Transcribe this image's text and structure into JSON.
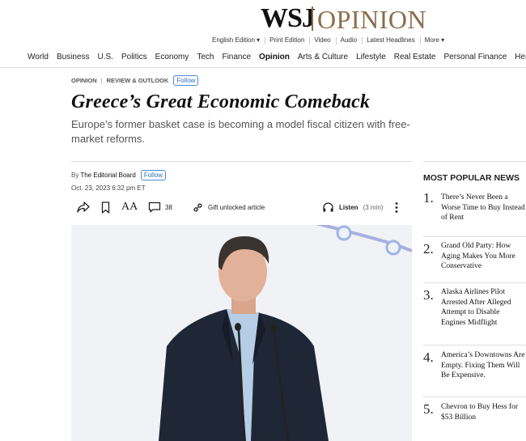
{
  "masthead": {
    "brand": "WSJ",
    "section": "OPINION"
  },
  "utility_nav": [
    "English Edition ▾",
    "Print Edition",
    "Video",
    "Audio",
    "Latest Headlines",
    "More ▾"
  ],
  "main_nav": [
    "World",
    "Business",
    "U.S.",
    "Politics",
    "Economy",
    "Tech",
    "Finance",
    "Opinion",
    "Arts & Culture",
    "Lifestyle",
    "Real Estate",
    "Personal Finance",
    "Hea"
  ],
  "main_nav_active": "Opinion",
  "article": {
    "kicker_1": "OPINION",
    "kicker_2": "REVIEW & OUTLOOK",
    "follow_label": "Follow",
    "headline": "Greece’s Great Economic Comeback",
    "dek": "Europe’s former basket case is becoming a model fiscal citizen with free-market reforms.",
    "byline_prefix": "By",
    "author": "The Editorial Board",
    "author_follow_label": "Follow",
    "date": "Oct. 23, 2023 6:32 pm ET",
    "comment_count": "38",
    "gift_label": "Gift unlocked article",
    "listen_label": "Listen",
    "listen_duration": "(3 min)",
    "font_size_label": "AA"
  },
  "most_popular": {
    "title": "MOST POPULAR NEWS",
    "items": [
      {
        "num": "1.",
        "text": "There’s Never Been a Worse Time to Buy Instead of Rent"
      },
      {
        "num": "2.",
        "text": "Grand Old Party: How Aging Makes You More Conservative"
      },
      {
        "num": "3.",
        "text": "Alaska Airlines Pilot Arrested After Alleged Attempt to Disable Engines Midflight"
      },
      {
        "num": "4.",
        "text": "America’s Downtowns Are Empty. Fixing Them Will Be Expensive."
      },
      {
        "num": "5.",
        "text": "Chevron to Buy Hess for $53 Billion"
      }
    ]
  },
  "colors": {
    "opinion_brown": "#8a6e4b",
    "follow_blue": "#2f6fbf",
    "text_dark": "#111111",
    "text_muted": "#555555"
  }
}
